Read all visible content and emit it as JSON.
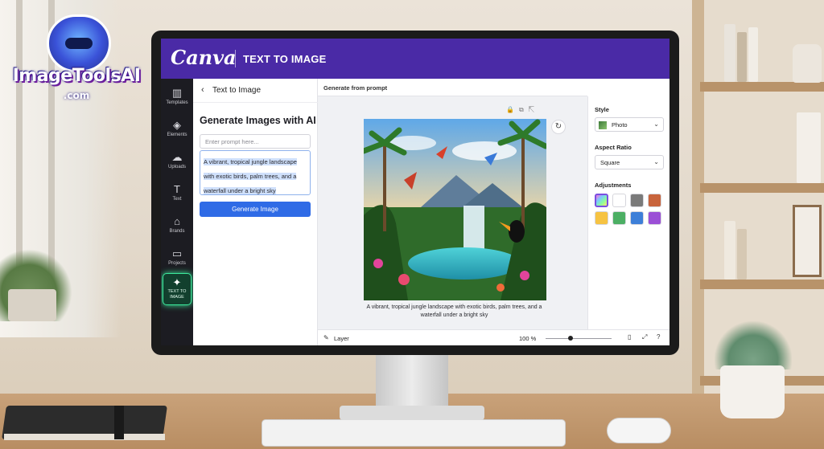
{
  "logo": {
    "name": "ImageToolsAI",
    "domain": ".com"
  },
  "app": {
    "brand": "Canva",
    "title": "TEXT TO IMAGE"
  },
  "sidebar_rail": {
    "items": [
      {
        "label": "Templates",
        "icon": "templates-icon",
        "glyph": "▥"
      },
      {
        "label": "Elements",
        "icon": "elements-icon",
        "glyph": "◈"
      },
      {
        "label": "Uploads",
        "icon": "uploads-icon",
        "glyph": "☁"
      },
      {
        "label": "Text",
        "icon": "text-icon",
        "glyph": "T"
      },
      {
        "label": "Brands",
        "icon": "brands-icon",
        "glyph": "⌂"
      },
      {
        "label": "Projects",
        "icon": "projects-icon",
        "glyph": "▭"
      }
    ],
    "active": {
      "label_line1": "TEXT TO",
      "label_line2": "IMAGE",
      "icon": "text-to-image-icon",
      "glyph": "✦"
    }
  },
  "panel": {
    "back_glyph": "‹",
    "breadcrumb": "Text to Image",
    "heading": "Generate Images with AI",
    "prompt_placeholder": "Enter prompt here...",
    "prompt_value": "A vibrant, tropical jungle landscape with exotic birds, palm trees, and a waterfall under a bright sky",
    "generate_label": "Generate Image"
  },
  "canvas": {
    "header": "Generate from prompt",
    "tool_glyphs": "🔒⧉⇱",
    "refresh_glyph": "↻",
    "caption": "A vibrant, tropical jungle landscape with exotic birds, palm trees, and a waterfall under a bright sky"
  },
  "statusbar": {
    "layer_glyph": "✎",
    "layer_label": "Layer",
    "zoom_value": "100 %",
    "zoom_fraction": 0.38,
    "pages_glyph": "▯",
    "expand_glyph": "⤢",
    "help_glyph": "?"
  },
  "properties": {
    "style_label": "Style",
    "style_value": "Photo",
    "aspect_label": "Aspect Ratio",
    "aspect_value": "Square",
    "chevron_glyph": "⌄",
    "adjustments_label": "Adjustments",
    "adjustment_swatches": [
      "#9c6cf0",
      "#ffffff",
      "#7a7a7a",
      "#c8643c",
      "#f6c342",
      "#4caf64",
      "#3d7fd8",
      "#9b4fd6"
    ]
  },
  "colors": {
    "topbar": "#4a2aa6",
    "rail": "#1c1c22",
    "active_glow": "#3ce89b",
    "primary": "#2f6be6"
  }
}
